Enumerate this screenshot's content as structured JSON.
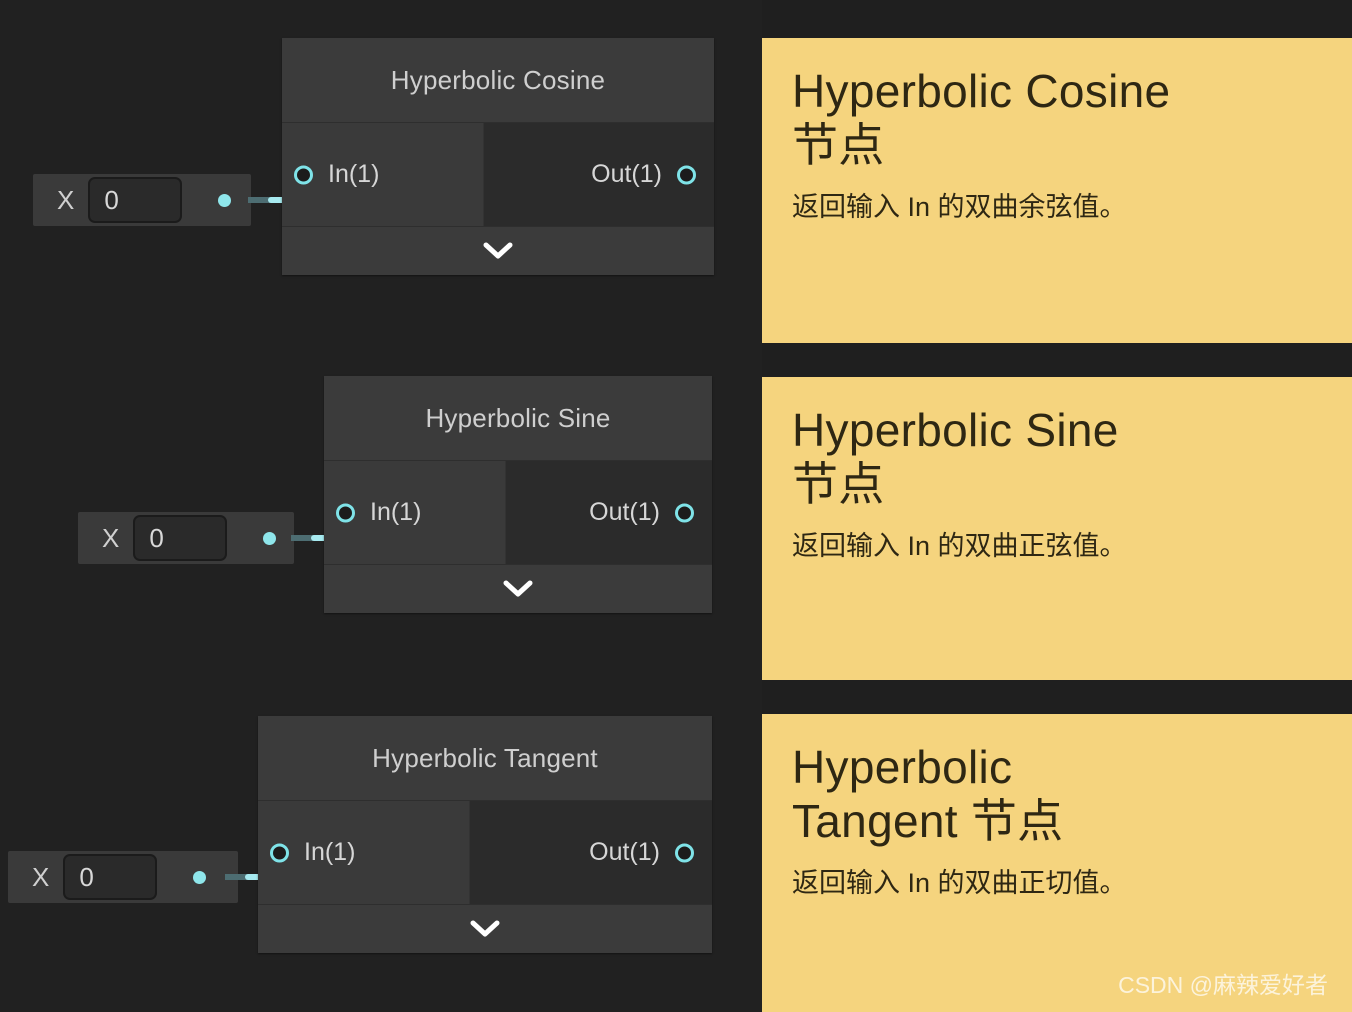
{
  "theme": {
    "background": "#1f1f1f",
    "graph_background": "#212121",
    "node_background": "#3a3a3a",
    "node_out_background": "#2b2b2b",
    "accent_wire": "#a7eaf0",
    "note_background": "#f5d47e",
    "note_text": "#2e2713"
  },
  "nodes": [
    {
      "title": "Hyperbolic Cosine",
      "input_label": "In(1)",
      "output_label": "Out(1)",
      "expand_icon": "chevron-down-icon",
      "value_field": {
        "label": "X",
        "value": "0"
      }
    },
    {
      "title": "Hyperbolic Sine",
      "input_label": "In(1)",
      "output_label": "Out(1)",
      "expand_icon": "chevron-down-icon",
      "value_field": {
        "label": "X",
        "value": "0"
      }
    },
    {
      "title": "Hyperbolic Tangent",
      "input_label": "In(1)",
      "output_label": "Out(1)",
      "expand_icon": "chevron-down-icon",
      "value_field": {
        "label": "X",
        "value": "0"
      }
    }
  ],
  "notes": [
    {
      "title": "Hyperbolic Cosine\n节点",
      "description": "返回输入 In 的双曲余弦值。"
    },
    {
      "title": "Hyperbolic Sine\n节点",
      "description": "返回输入 In 的双曲正弦值。"
    },
    {
      "title": "Hyperbolic\nTangent 节点",
      "description": "返回输入 In 的双曲正切值。"
    }
  ],
  "watermark": "CSDN @麻辣爱好者"
}
